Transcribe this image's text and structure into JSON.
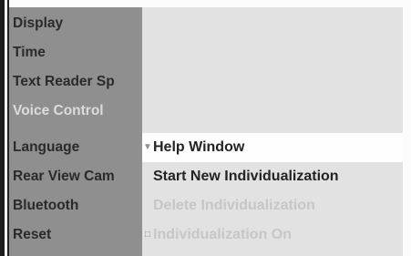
{
  "sidebar": {
    "items": [
      {
        "label": "Display"
      },
      {
        "label": "Time"
      },
      {
        "label": "Text Reader Sp"
      },
      {
        "label": "Voice Control"
      },
      {
        "label": "Language"
      },
      {
        "label": "Rear View Cam"
      },
      {
        "label": "Bluetooth"
      },
      {
        "label": "Reset"
      }
    ]
  },
  "menu": {
    "items": [
      {
        "label": "Help Window",
        "marker": "▼",
        "state": "selected"
      },
      {
        "label": "Start New Individualization",
        "marker": "",
        "state": "normal"
      },
      {
        "label": "Delete Individualization",
        "marker": "",
        "state": "disabled"
      },
      {
        "label": "Individualization On",
        "marker": "□",
        "state": "disabled"
      }
    ]
  },
  "colors": {
    "sidebar_bg": "#8f8f8f",
    "panel_bg": "#e2e2e2",
    "selected_bg": "#fefefe",
    "active_text": "#dcdcdc",
    "disabled_text": "#c6c6c6"
  }
}
